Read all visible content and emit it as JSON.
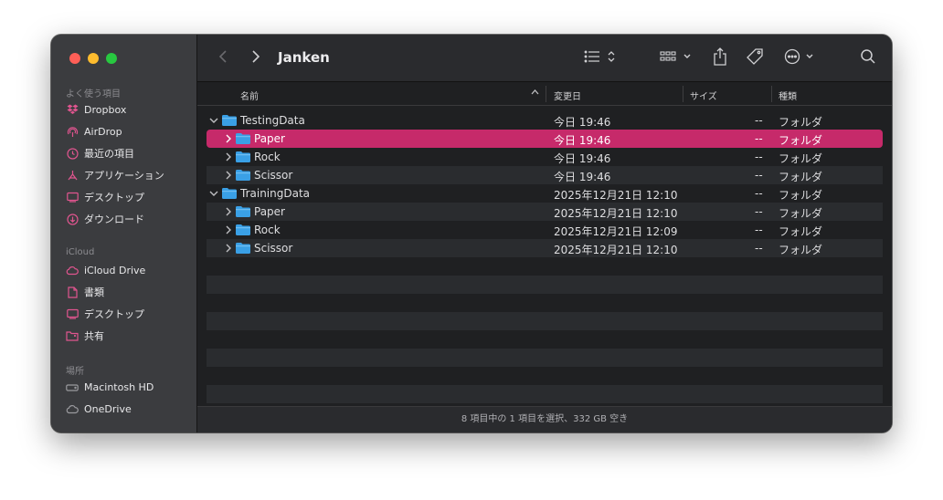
{
  "window": {
    "title": "Janken"
  },
  "sidebar": {
    "favorites_label": "よく使う項目",
    "favorites": [
      {
        "label": "Dropbox",
        "icon": "dropbox-icon"
      },
      {
        "label": "AirDrop",
        "icon": "airdrop-icon"
      },
      {
        "label": "最近の項目",
        "icon": "clock-icon"
      },
      {
        "label": "アプリケーション",
        "icon": "applications-icon"
      },
      {
        "label": "デスクトップ",
        "icon": "desktop-icon"
      },
      {
        "label": "ダウンロード",
        "icon": "download-icon"
      }
    ],
    "icloud_label": "iCloud",
    "icloud": [
      {
        "label": "iCloud Drive",
        "icon": "cloud-icon"
      },
      {
        "label": "書類",
        "icon": "document-icon"
      },
      {
        "label": "デスクトップ",
        "icon": "desktop-icon"
      },
      {
        "label": "共有",
        "icon": "shared-folder-icon"
      }
    ],
    "locations_label": "場所",
    "locations": [
      {
        "label": "Macintosh HD",
        "icon": "disk-icon"
      },
      {
        "label": "OneDrive",
        "icon": "cloud-icon"
      }
    ]
  },
  "columns": {
    "name": "名前",
    "date": "変更日",
    "size": "サイズ",
    "kind": "種類"
  },
  "files": [
    {
      "name": "TestingData",
      "date": "今日 19:46",
      "size": "--",
      "kind": "フォルダ"
    },
    {
      "name": "Paper",
      "date": "今日 19:46",
      "size": "--",
      "kind": "フォルダ"
    },
    {
      "name": "Rock",
      "date": "今日 19:46",
      "size": "--",
      "kind": "フォルダ"
    },
    {
      "name": "Scissor",
      "date": "今日 19:46",
      "size": "--",
      "kind": "フォルダ"
    },
    {
      "name": "TrainingData",
      "date": "2025年12月21日 12:10",
      "size": "--",
      "kind": "フォルダ"
    },
    {
      "name": "Paper",
      "date": "2025年12月21日 12:10",
      "size": "--",
      "kind": "フォルダ"
    },
    {
      "name": "Rock",
      "date": "2025年12月21日 12:09",
      "size": "--",
      "kind": "フォルダ"
    },
    {
      "name": "Scissor",
      "date": "2025年12月21日 12:10",
      "size": "--",
      "kind": "フォルダ"
    }
  ],
  "status": {
    "text": "8 項目中の 1 項目を選択、332 GB 空き"
  },
  "colors": {
    "selection": "#c62a6a",
    "sidebar_icon": "#e0558f",
    "folder": "#3aa0e6"
  }
}
